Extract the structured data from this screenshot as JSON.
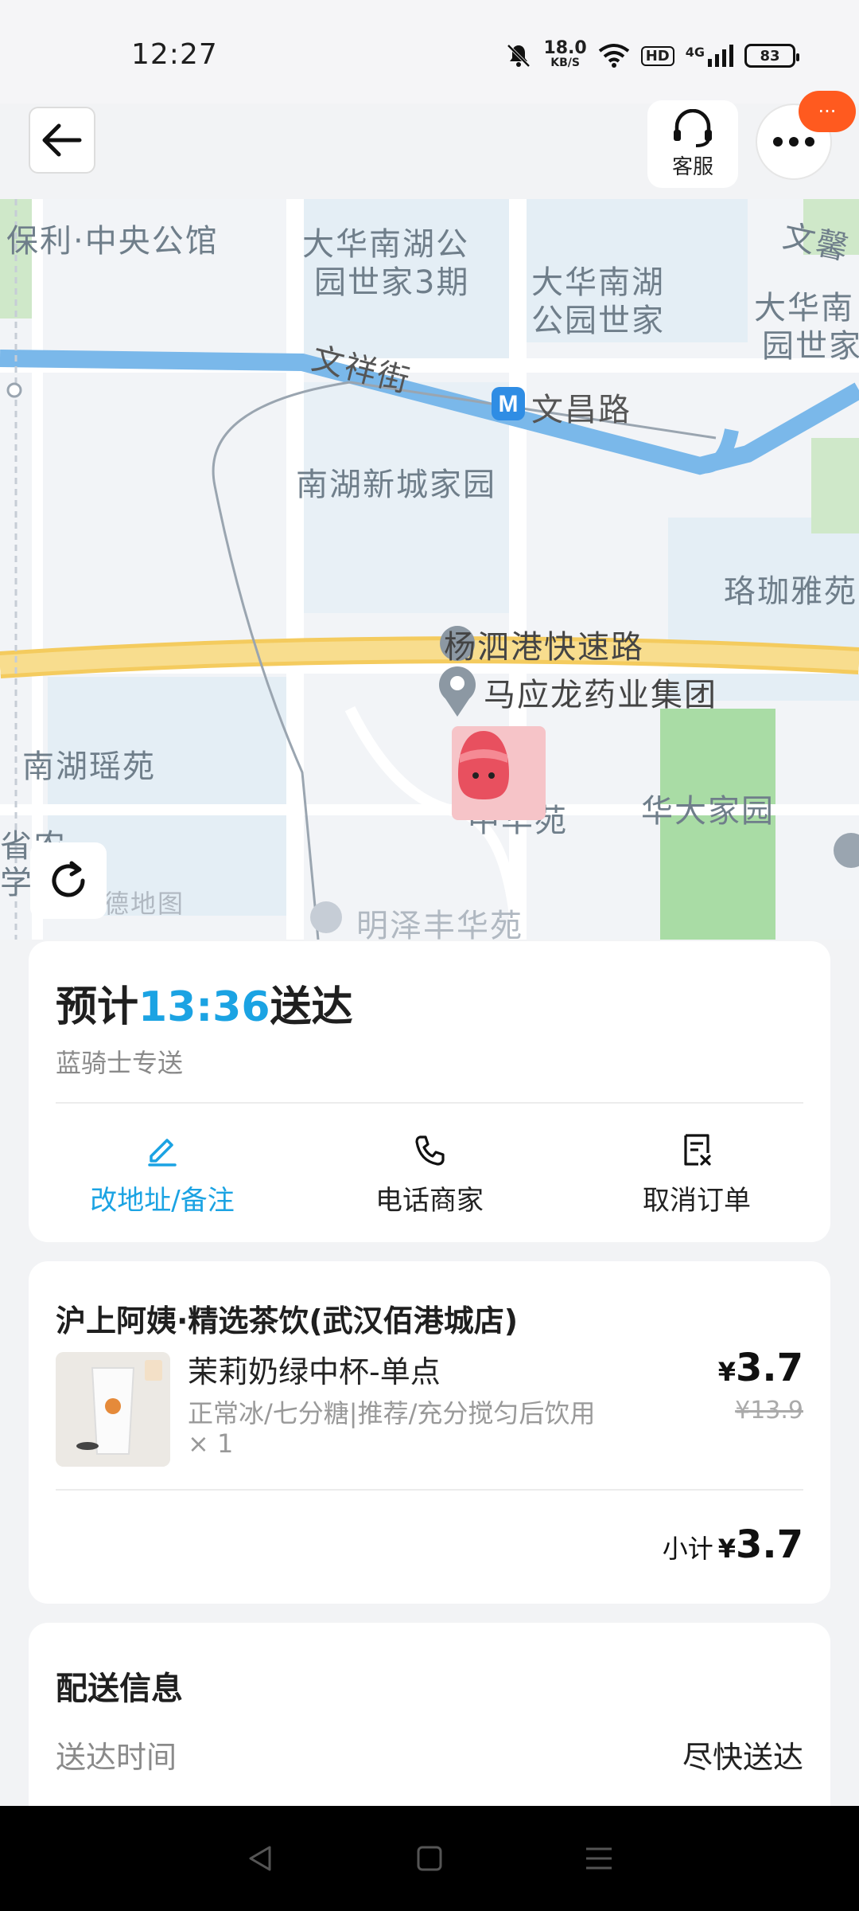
{
  "status": {
    "time": "12:27",
    "speed_value": "18.0",
    "speed_unit": "KB/S",
    "hd": "HD",
    "network": "4G",
    "battery": "83"
  },
  "header": {
    "service_label": "客服",
    "notif_text": "···"
  },
  "map": {
    "labels": {
      "l1": "保利·中央公馆",
      "l2a": "大华南湖公",
      "l2b": "园世家3期",
      "l3a": "大华南湖",
      "l3b": "公园世家",
      "l4a": "大华南",
      "l4b": "园世家",
      "l5": "文馨",
      "l6": "文祥街",
      "l7": "文昌路",
      "l8": "南湖新城家园",
      "l9": "珞珈雅苑",
      "l10": "杨泗港快速路",
      "l11": "马应龙药业集团",
      "l12": "南湖瑶苑",
      "l13": "华大家园",
      "l14": "中华苑",
      "l15": "明泽丰华苑",
      "l16": "德地图",
      "l17": "省农",
      "l18": "学"
    }
  },
  "eta": {
    "prefix": "预计",
    "time": "13:36",
    "suffix": "送达",
    "sub": "蓝骑士专送"
  },
  "actions": {
    "change_address": "改地址/备注",
    "call_merchant": "电话商家",
    "cancel_order": "取消订单"
  },
  "order": {
    "shop_name": "沪上阿姨·精选茶饮(武汉佰港城店)",
    "item_name": "茉莉奶绿中杯-单点",
    "item_spec": "正常冰/七分糖|推荐/充分搅匀后饮用",
    "item_qty": "× 1",
    "currency": "¥",
    "price": "3.7",
    "orig_price": "¥13.9",
    "subtotal_label": "小计",
    "subtotal": "3.7"
  },
  "delivery": {
    "title": "配送信息",
    "time_label": "送达时间",
    "time_value": "尽快送达"
  },
  "colors": {
    "accent": "#1ba3e3",
    "notif": "#ff5a1f",
    "road_main": "#f7d57a",
    "river": "#7ab8ea"
  }
}
